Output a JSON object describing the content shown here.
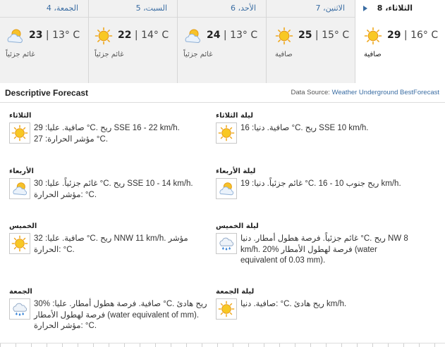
{
  "days": [
    {
      "name": "الجمعة، 4",
      "high": "23",
      "low": "13° C",
      "cond": "غائم جزئياً",
      "icon": "partly-cloudy-icon"
    },
    {
      "name": "السبت، 5",
      "high": "22",
      "low": "14° C",
      "cond": "غائم جزئياً",
      "icon": "sunny-icon"
    },
    {
      "name": "الأحد، 6",
      "high": "24",
      "low": "13° C",
      "cond": "غائم جزئياً",
      "icon": "partly-cloudy-icon"
    },
    {
      "name": "الاثنين، 7",
      "high": "25",
      "low": "15° C",
      "cond": "صافية",
      "icon": "sunny-icon"
    },
    {
      "name": "الثلاثاء، 8",
      "high": "29",
      "low": "16° C",
      "cond": "صافية",
      "icon": "sunny-icon",
      "selected": true
    }
  ],
  "temp_sep": " | ",
  "descriptive": {
    "title": "Descriptive Forecast",
    "source_label": "Data Source: ",
    "source_link": "Weather Underground BestForecast"
  },
  "blocks": [
    {
      "title": "الثلاثاء",
      "icon": "sunny-icon",
      "lines": [
        "صافية. عليا: 29 °C. ريح SSE 16 - 22 km/h.",
        "مؤشر الحرارة: 27 °C."
      ]
    },
    {
      "title": "ليلة الثلاثاء",
      "icon": "sunny-icon",
      "lines": [
        "صافية. دنيا: 16 °C. ريح SSE 10 km/h."
      ]
    },
    {
      "title": "الأربعاء",
      "icon": "partly-cloudy-icon",
      "lines": [
        "غائم جزئياً. عليا: 30 °C. ريح SSE 10 - 14 km/h.",
        "مؤشر الحرارة: °C."
      ]
    },
    {
      "title": "ليلة الأربعاء",
      "icon": "partly-cloudy-icon",
      "lines": [
        "غائم جزئياً. دنيا: 19 °C. ريح جنوب 10 - 16 km/h."
      ]
    },
    {
      "title": "الخميس",
      "icon": "sunny-icon",
      "lines": [
        "صافية. عليا: 32 °C. ريح NNW 11 km/h. مؤشر",
        "الحرارة: °C."
      ]
    },
    {
      "title": "ليلة الخميس",
      "icon": "rain-icon",
      "lines": [
        "غائم جزئياً. فرصة هطول أمطار. دنيا °C. ريح NW 8",
        "km/h. 20% فرصة لهطول الأمطار (water",
        "equivalent of 0.03 mm)."
      ]
    },
    {
      "title": "الجمعة",
      "icon": "rain-icon",
      "lines": [
        "صافية. فرصة هطول أمطار. عليا: %30 °C. ريح هادئ",
        "فرصة لهطول الأمطار (water equivalent of mm).",
        "مؤشر الحرارة: °C."
      ]
    },
    {
      "title": "ليلة الجمعة",
      "icon": "sunny-icon",
      "lines": [
        "صافية. دنيا: °C. ريح هادئ km/h."
      ]
    }
  ]
}
